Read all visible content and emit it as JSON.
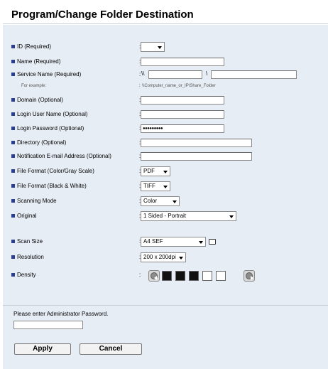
{
  "page": {
    "title": "Program/Change Folder Destination"
  },
  "fields": {
    "id": {
      "label": "ID (Required)",
      "value": ""
    },
    "name": {
      "label": "Name (Required)",
      "value": ""
    },
    "service_name": {
      "label": "Service Name (Required)",
      "prefix": "\\\\",
      "separator": "\\",
      "server_value": "",
      "folder_value": ""
    },
    "example": {
      "label": "For example:",
      "value": "\\\\Computer_name_or_IP\\Share_Folder"
    },
    "domain": {
      "label": "Domain (Optional)",
      "value": ""
    },
    "login_user": {
      "label": "Login User Name (Optional)",
      "value": ""
    },
    "login_password": {
      "label": "Login Password (Optional)",
      "value": "●●●●●●●●●"
    },
    "directory": {
      "label": "Directory (Optional)",
      "value": ""
    },
    "notification_email": {
      "label": "Notification E-mail Address (Optional)",
      "value": ""
    },
    "file_format_color": {
      "label": "File Format (Color/Gray Scale)",
      "value": "PDF"
    },
    "file_format_bw": {
      "label": "File Format (Black & White)",
      "value": "TIFF"
    },
    "scanning_mode": {
      "label": "Scanning Mode",
      "value": "Color"
    },
    "original": {
      "label": "Original",
      "value": "1 Sided - Portrait"
    },
    "scan_size": {
      "label": "Scan Size",
      "value": "A4 SEF"
    },
    "resolution": {
      "label": "Resolution",
      "value": "200 x 200dpi"
    },
    "density": {
      "label": "Density",
      "level": 3,
      "levels": 5
    }
  },
  "colon": ":",
  "admin": {
    "prompt": "Please enter Administrator Password.",
    "value": ""
  },
  "buttons": {
    "apply": "Apply",
    "cancel": "Cancel"
  },
  "colors": {
    "panel_bg": "#e7edf5",
    "bullet": "#2c3e8f"
  },
  "icons": {
    "paper_orientation": "paper-orientation-icon",
    "density_left": "arrow-left-icon",
    "density_right": "arrow-right-icon"
  }
}
